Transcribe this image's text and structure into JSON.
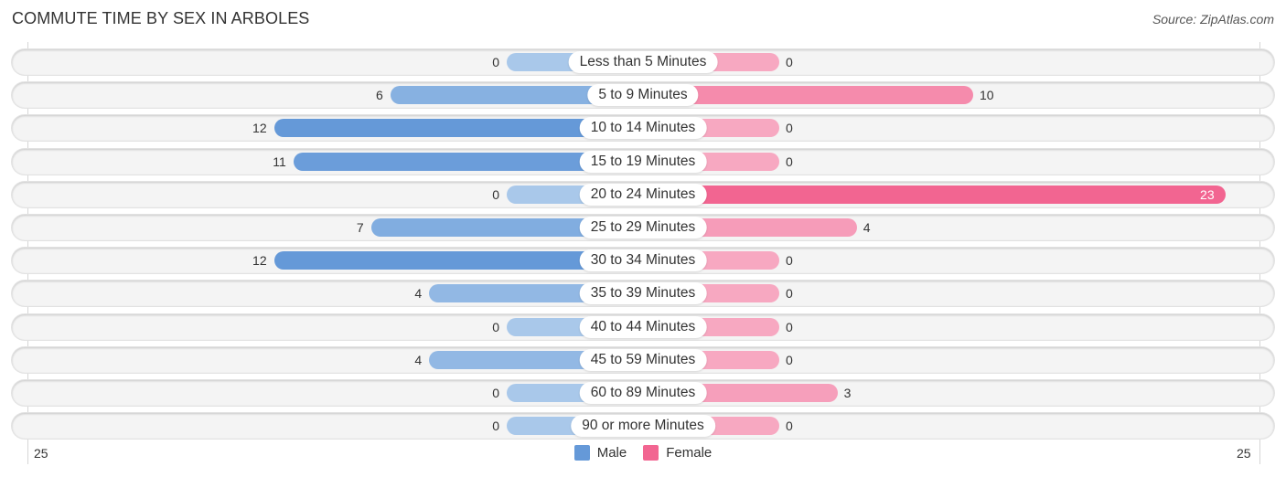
{
  "title": "COMMUTE TIME BY SEX IN ARBOLES",
  "source": "Source: ZipAtlas.com",
  "colors": {
    "male_strong": "#6599d8",
    "male_light": "#a9c8ea",
    "female_strong": "#f26591",
    "female_light": "#f7a8c1"
  },
  "chart_data": {
    "type": "bar",
    "orientation": "horizontal-diverging",
    "title": "COMMUTE TIME BY SEX IN ARBOLES",
    "categories": [
      "Less than 5 Minutes",
      "5 to 9 Minutes",
      "10 to 14 Minutes",
      "15 to 19 Minutes",
      "20 to 24 Minutes",
      "25 to 29 Minutes",
      "30 to 34 Minutes",
      "35 to 39 Minutes",
      "40 to 44 Minutes",
      "45 to 59 Minutes",
      "60 to 89 Minutes",
      "90 or more Minutes"
    ],
    "series": [
      {
        "name": "Male",
        "values": [
          0,
          6,
          12,
          11,
          0,
          7,
          12,
          4,
          0,
          4,
          0,
          0
        ]
      },
      {
        "name": "Female",
        "values": [
          0,
          10,
          0,
          0,
          23,
          4,
          0,
          0,
          0,
          0,
          3,
          0
        ]
      }
    ],
    "axis": {
      "left_label": "25",
      "right_label": "25",
      "max": 25
    },
    "legend": {
      "position": "bottom-center",
      "items": [
        "Male",
        "Female"
      ]
    },
    "grid": false
  }
}
